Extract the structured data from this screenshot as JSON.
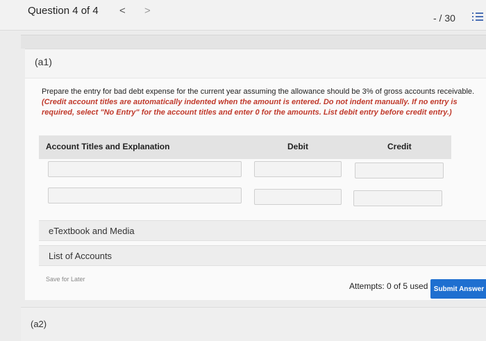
{
  "header": {
    "question_label": "Question 4 of 4",
    "prev_symbol": "<",
    "next_symbol": ">",
    "score": "- / 30"
  },
  "part_a1": {
    "label": "(a1)"
  },
  "prompt": {
    "text": "Prepare the entry for bad debt expense for the current year assuming the allowance should be 3% of gross accounts receivable.",
    "instruction": "(Credit account titles are automatically indented when the amount is entered. Do not indent manually. If no entry is required, select \"No Entry\" for the account titles and enter 0 for the amounts. List debit entry before credit entry.)"
  },
  "table": {
    "col_account": "Account Titles and Explanation",
    "col_debit": "Debit",
    "col_credit": "Credit",
    "rows": [
      {
        "account": "",
        "debit": "",
        "credit": ""
      },
      {
        "account": "",
        "debit": "",
        "credit": ""
      }
    ]
  },
  "resources": {
    "etextbook": "eTextbook and Media",
    "accounts": "List of Accounts"
  },
  "actions": {
    "save_later": "Save for Later",
    "attempts": "Attempts: 0 of 5 used",
    "submit": "Submit Answer"
  },
  "part_a2": {
    "label": "(a2)"
  },
  "colors": {
    "accent": "#1e6fd0",
    "instruction_red": "#c0392b"
  }
}
